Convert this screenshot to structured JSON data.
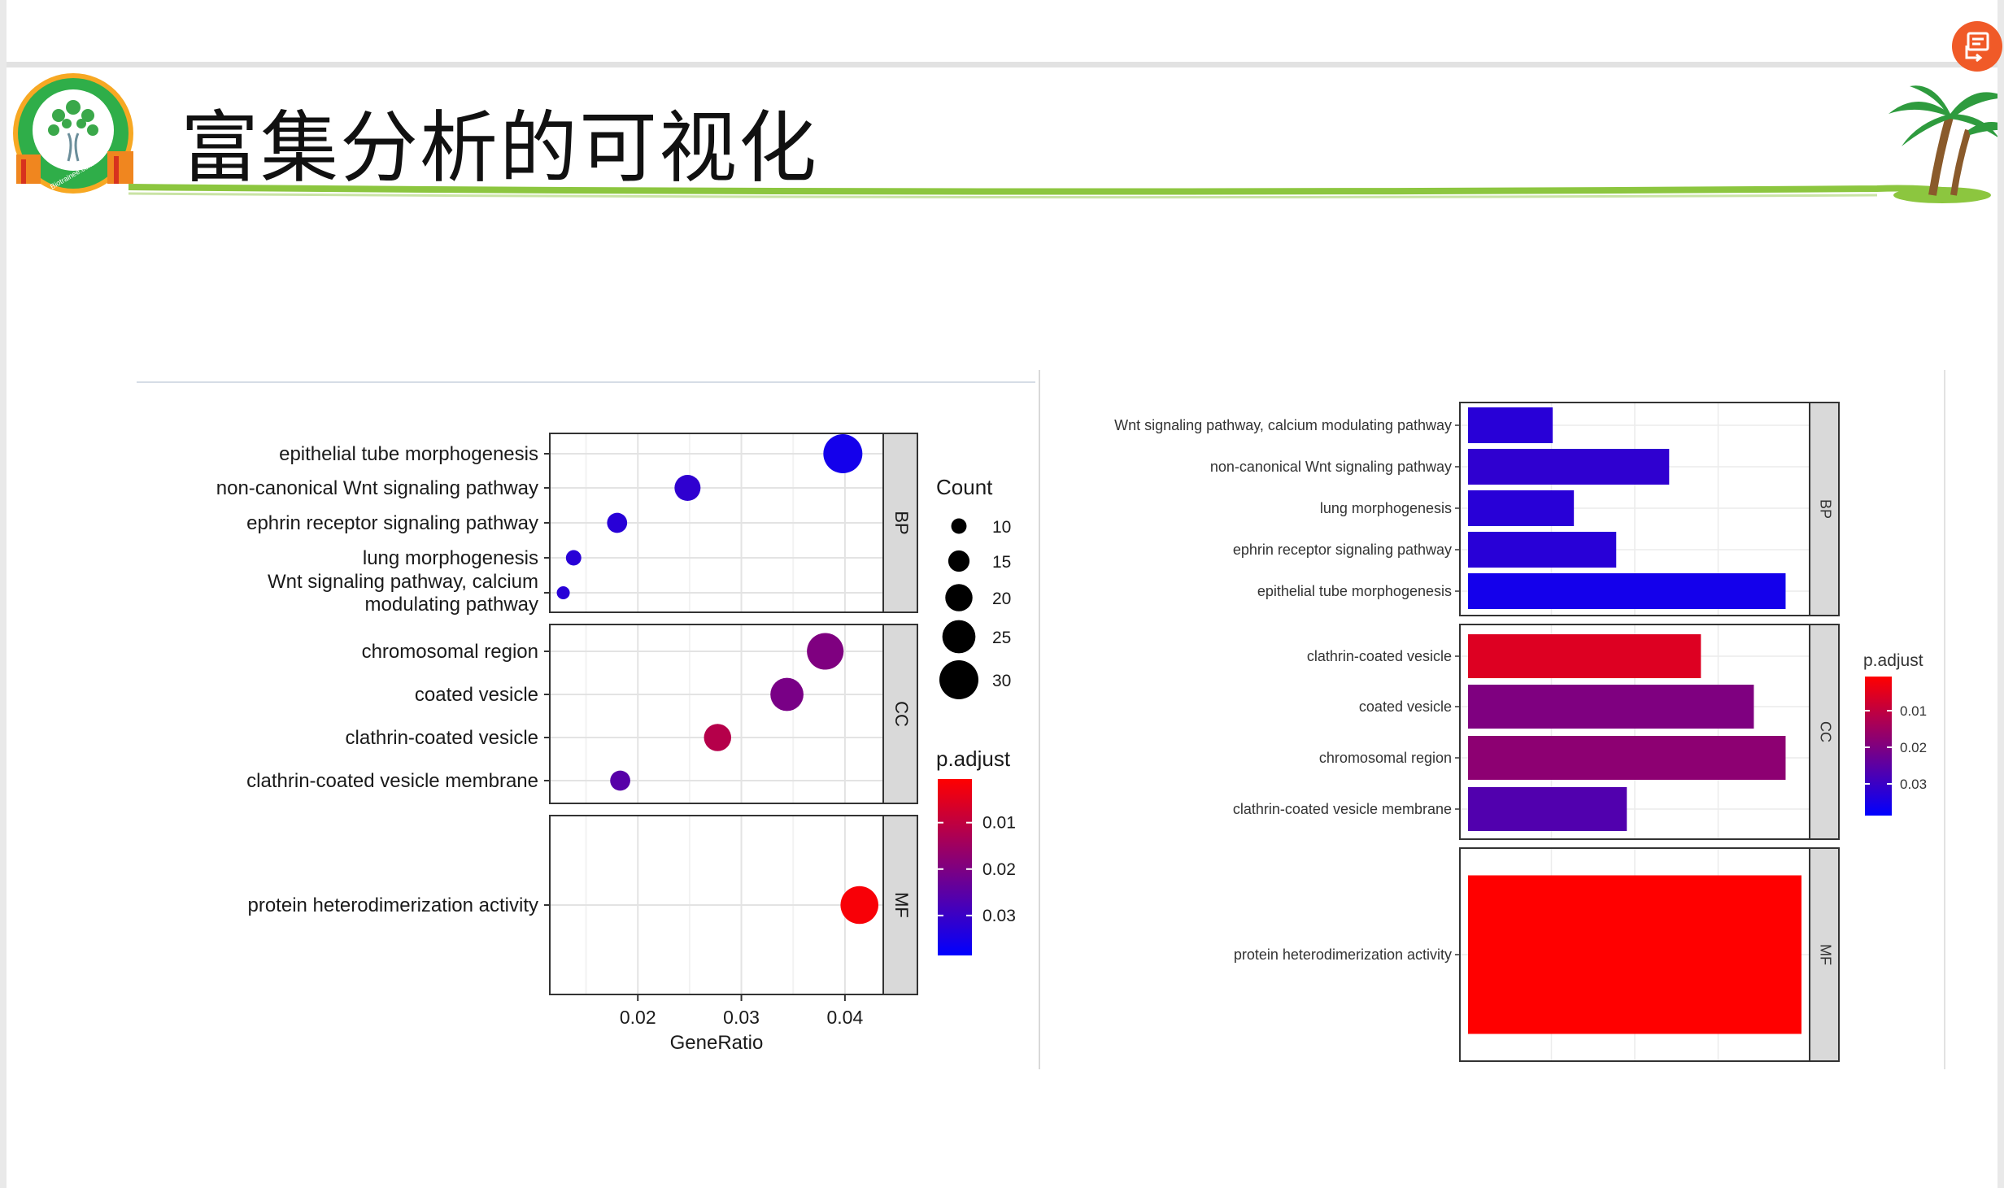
{
  "slide": {
    "title": "富集分析的可视化",
    "logo_text": "Biotrainee.com",
    "accent_color": "#8cc63f",
    "share_button_color": "#f05a28",
    "icons": [
      "logo-icon",
      "palm-tree-icon",
      "share-icon"
    ]
  },
  "chart_data": [
    {
      "type": "scatter",
      "chart": "dotplot",
      "xlabel": "GeneRatio",
      "xlim": [
        0.0115,
        0.0437
      ],
      "x_ticks": [
        0.02,
        0.03,
        0.04
      ],
      "x_tick_labels": [
        "0.02",
        "0.03",
        "0.04"
      ],
      "grid": true,
      "legend_position": "right",
      "facets": [
        {
          "name": "BP",
          "terms": [
            {
              "label": "epithelial tube morphogenesis",
              "x": 0.0398,
              "count": 30,
              "padj": 0.037
            },
            {
              "label": "non-canonical Wnt signaling pathway",
              "x": 0.0248,
              "count": 19,
              "padj": 0.033
            },
            {
              "label": "ephrin receptor signaling pathway",
              "x": 0.018,
              "count": 14,
              "padj": 0.034
            },
            {
              "label": "lung morphogenesis",
              "x": 0.0138,
              "count": 10,
              "padj": 0.034
            },
            {
              "label": "Wnt signaling pathway, calcium modulating pathway",
              "x": 0.0128,
              "count": 8,
              "padj": 0.034
            }
          ]
        },
        {
          "name": "CC",
          "terms": [
            {
              "label": "chromosomal region",
              "x": 0.0381,
              "count": 28,
              "padj": 0.021
            },
            {
              "label": "coated vesicle",
              "x": 0.0344,
              "count": 25,
              "padj": 0.022
            },
            {
              "label": "clathrin-coated vesicle",
              "x": 0.0277,
              "count": 20,
              "padj": 0.013
            },
            {
              "label": "clathrin-coated vesicle membrane",
              "x": 0.0183,
              "count": 14,
              "padj": 0.027
            }
          ]
        },
        {
          "name": "MF",
          "terms": [
            {
              "label": "protein heterodimerization activity",
              "x": 0.0414,
              "count": 29,
              "padj": 0.003
            }
          ]
        }
      ],
      "size_legend": {
        "title": "Count",
        "values": [
          10,
          15,
          20,
          25,
          30
        ]
      },
      "color_legend": {
        "title": "p.adjust",
        "ticks": [
          0.01,
          0.02,
          0.03
        ],
        "tick_labels": [
          "0.01",
          "0.02",
          "0.03"
        ],
        "range": [
          0.002,
          0.04
        ],
        "low_color": "#ff0000",
        "high_color": "#0000ff"
      }
    },
    {
      "type": "bar",
      "orientation": "horizontal",
      "xlim": [
        0,
        31.5
      ],
      "grid": true,
      "legend_position": "right",
      "facets": [
        {
          "name": "BP",
          "bars": [
            {
              "label": "Wnt signaling pathway, calcium modulating pathway",
              "value": 8,
              "padj": 0.034
            },
            {
              "label": "non-canonical Wnt signaling pathway",
              "value": 19,
              "padj": 0.033
            },
            {
              "label": "lung morphogenesis",
              "value": 10,
              "padj": 0.034
            },
            {
              "label": "ephrin receptor signaling pathway",
              "value": 14,
              "padj": 0.034
            },
            {
              "label": "epithelial tube morphogenesis",
              "value": 30,
              "padj": 0.037
            }
          ]
        },
        {
          "name": "CC",
          "bars": [
            {
              "label": "clathrin-coated vesicle",
              "value": 22,
              "padj": 0.007
            },
            {
              "label": "coated vesicle",
              "value": 27,
              "padj": 0.021
            },
            {
              "label": "chromosomal region",
              "value": 30,
              "padj": 0.019
            },
            {
              "label": "clathrin-coated vesicle membrane",
              "value": 15,
              "padj": 0.028
            }
          ]
        },
        {
          "name": "MF",
          "bars": [
            {
              "label": "protein heterodimerization activity",
              "value": 31.5,
              "padj": 0.002
            }
          ]
        }
      ],
      "color_legend": {
        "title": "p.adjust",
        "ticks": [
          0.01,
          0.02,
          0.03
        ],
        "tick_labels": [
          "0.01",
          "0.02",
          "0.03"
        ],
        "range": [
          0.002,
          0.04
        ],
        "low_color": "#ff0000",
        "high_color": "#0000ff"
      }
    }
  ]
}
